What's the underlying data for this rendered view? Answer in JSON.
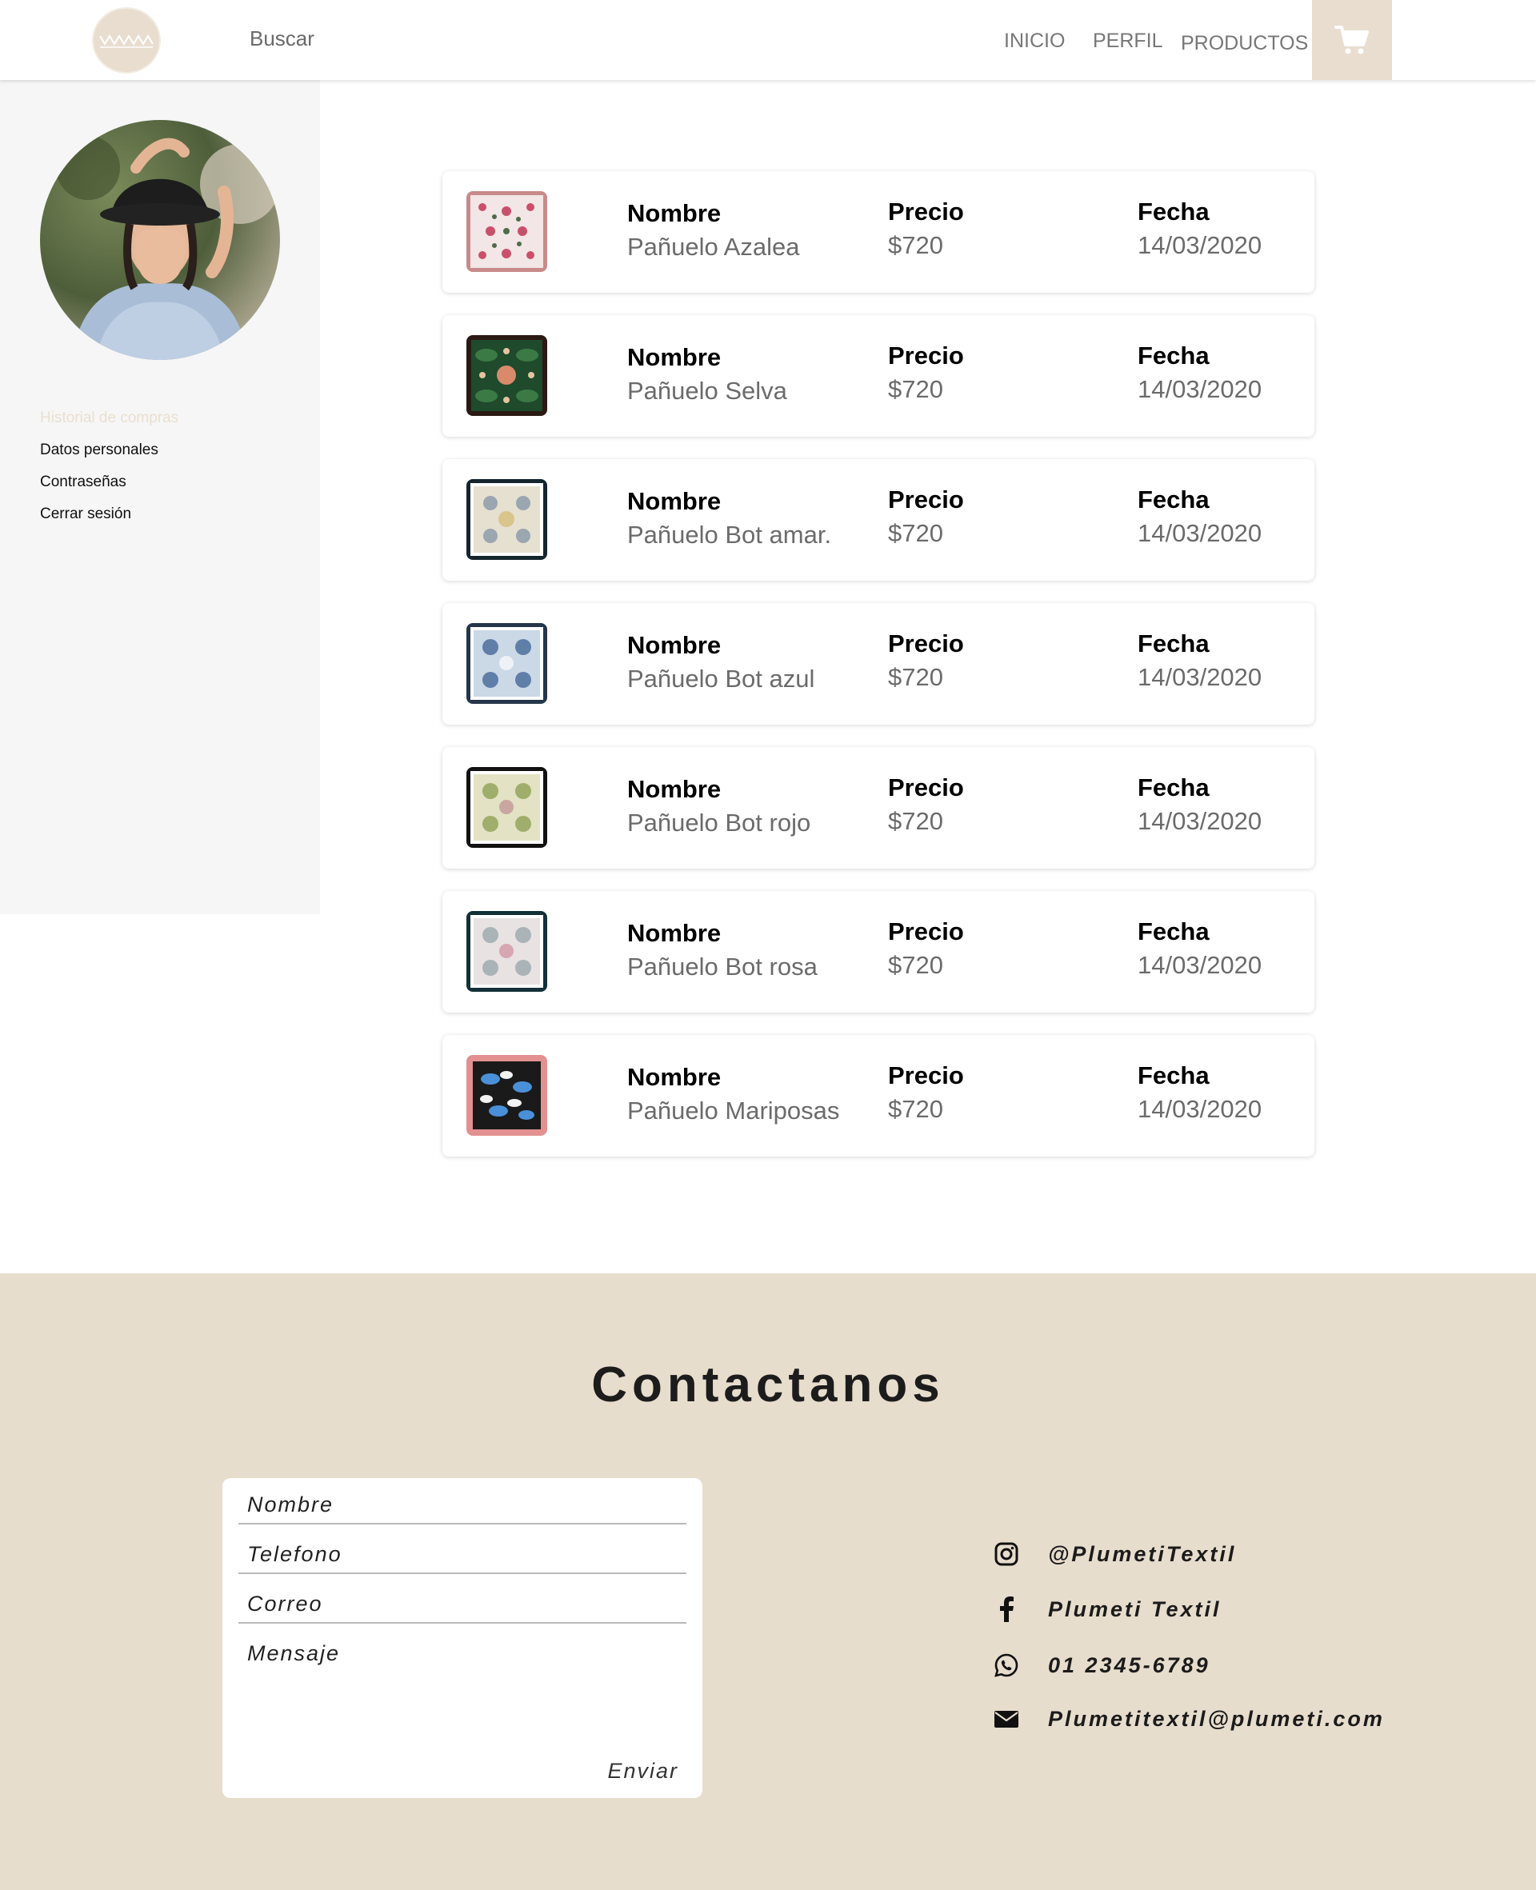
{
  "header": {
    "search_label": "Buscar",
    "nav": [
      "INICIO",
      "PERFIL",
      "PRODUCTOS"
    ],
    "cart_icon": "shopping-cart-icon"
  },
  "sidebar": {
    "items": [
      {
        "label": "Historial de compras",
        "active": true
      },
      {
        "label": "Datos personales",
        "active": false
      },
      {
        "label": "Contraseñas",
        "active": false
      },
      {
        "label": "Cerrar sesión",
        "active": false
      }
    ]
  },
  "orders": {
    "labels": {
      "name": "Nombre",
      "price": "Precio",
      "date": "Fecha"
    },
    "items": [
      {
        "name": "Pañuelo Azalea",
        "price": "$720",
        "date": "14/03/2020"
      },
      {
        "name": "Pañuelo Selva",
        "price": "$720",
        "date": "14/03/2020"
      },
      {
        "name": "Pañuelo Bot amar.",
        "price": "$720",
        "date": "14/03/2020"
      },
      {
        "name": "Pañuelo Bot azul",
        "price": "$720",
        "date": "14/03/2020"
      },
      {
        "name": "Pañuelo Bot rojo",
        "price": "$720",
        "date": "14/03/2020"
      },
      {
        "name": "Pañuelo Bot rosa",
        "price": "$720",
        "date": "14/03/2020"
      },
      {
        "name": "Pañuelo Mariposas",
        "price": "$720",
        "date": "14/03/2020"
      }
    ]
  },
  "contact": {
    "title": "Contactanos",
    "form": {
      "name_placeholder": "Nombre",
      "phone_placeholder": "Telefono",
      "email_placeholder": "Correo",
      "message_placeholder": "Mensaje",
      "send_label": "Enviar"
    },
    "social": [
      {
        "icon": "instagram-icon",
        "text": "@PlumetiTextil"
      },
      {
        "icon": "facebook-icon",
        "text": "Plumeti Textil"
      },
      {
        "icon": "whatsapp-icon",
        "text": "01 2345-6789"
      },
      {
        "icon": "envelope-icon",
        "text": "Plumetitextil@plumeti.com"
      }
    ]
  },
  "colors": {
    "accent": "#e7ddcd",
    "sidebar_bg": "#f6f6f6",
    "active_link": "#eadfcf",
    "muted_text": "#6b6b6b"
  }
}
